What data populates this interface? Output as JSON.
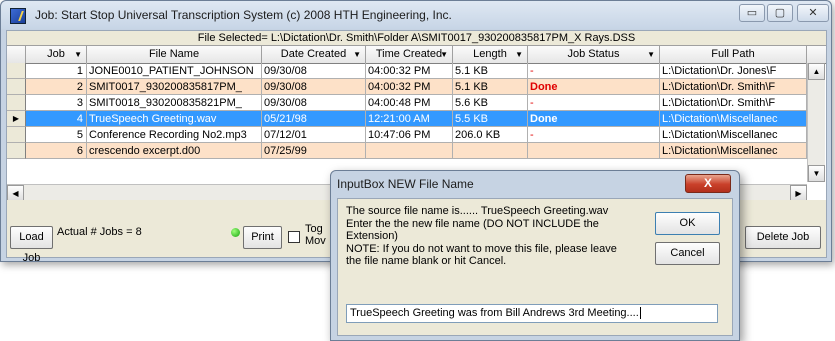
{
  "window": {
    "title": "Job: Start Stop Universal Transcription System (c) 2008 HTH Engineering, Inc.",
    "controls": {
      "minimize": "▭",
      "maximize": "▢",
      "close": "✕"
    }
  },
  "file_selected": "File Selected= L:\\Dictation\\Dr. Smith\\Folder A\\SMIT0017_930200835817PM_X Rays.DSS",
  "table": {
    "columns": [
      "Job",
      "File Name",
      "Date Created",
      "Time Created",
      "Length",
      "Job Status",
      "Full Path"
    ],
    "rows": [
      {
        "job": "1",
        "file": "JONE0010_PATIENT_JOHNSON",
        "date": "09/30/08",
        "time": "04:00:32 PM",
        "length": "5.1 KB",
        "status": "-",
        "path": "L:\\Dictation\\Dr. Jones\\F"
      },
      {
        "job": "2",
        "file": "SMIT0017_930200835817PM_",
        "date": "09/30/08",
        "time": "04:00:32 PM",
        "length": "5.1 KB",
        "status": "Done",
        "path": "L:\\Dictation\\Dr. Smith\\F"
      },
      {
        "job": "3",
        "file": "SMIT0018_930200835821PM_",
        "date": "09/30/08",
        "time": "04:00:48 PM",
        "length": "5.6 KB",
        "status": "-",
        "path": "L:\\Dictation\\Dr. Smith\\F"
      },
      {
        "job": "4",
        "file": "TrueSpeech Greeting.wav",
        "date": "05/21/98",
        "time": "12:21:00 AM",
        "length": "5.5 KB",
        "status": "Done",
        "path": "L:\\Dictation\\Miscellanec"
      },
      {
        "job": "5",
        "file": "Conference Recording No2.mp3",
        "date": "07/12/01",
        "time": "10:47:06 PM",
        "length": "206.0 KB",
        "status": "-",
        "path": "L:\\Dictation\\Miscellanec"
      },
      {
        "job": "6",
        "file": "crescendo excerpt.d00",
        "date": "07/25/99",
        "time": "",
        "length": "",
        "status": "",
        "path": "L:\\Dictation\\Miscellanec"
      }
    ],
    "selected_row": "4"
  },
  "footer": {
    "load_job": "Load Job",
    "actual_jobs": "Actual # Jobs = 8",
    "print": "Print",
    "toggle_label_1": "Tog",
    "toggle_label_2": "Mov",
    "delete_job": "Delete Job"
  },
  "dialog": {
    "title": "InputBox NEW File Name",
    "close": "X",
    "message_lines": [
      "The source file name is......     TrueSpeech Greeting.wav",
      "Enter the the new file name  (DO NOT INCLUDE the",
      "Extension)",
      "NOTE: If you do not want to move this file, please leave",
      "the file name blank or hit Cancel."
    ],
    "ok": "OK",
    "cancel": "Cancel",
    "input_value": "TrueSpeech Greeting was from Bill Andrews 3rd Meeting...."
  }
}
